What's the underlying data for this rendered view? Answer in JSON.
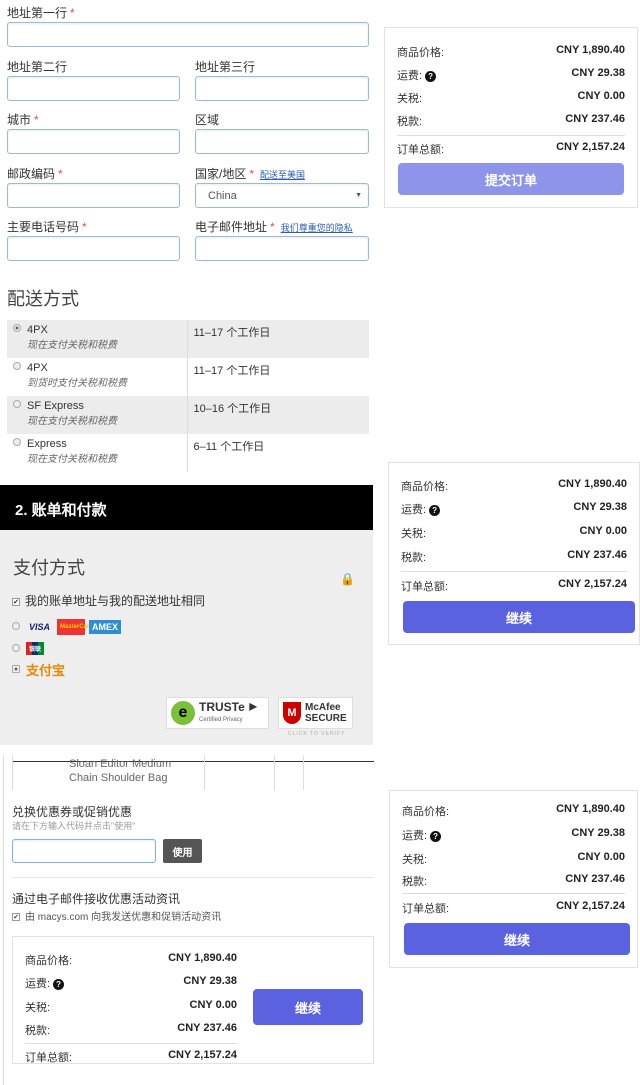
{
  "address_form": {
    "line1_label": "地址第一行",
    "line2_label": "地址第二行",
    "line3_label": "地址第三行",
    "city_label": "城市",
    "region_label": "区域",
    "postal_label": "邮政编码",
    "country_label": "国家/地区",
    "ship_to_us_link": "配送至美国",
    "country_value": "China",
    "phone_label": "主要电话号码",
    "email_label": "电子邮件地址",
    "privacy_link": "我们尊重您的隐私",
    "required_mark": "*"
  },
  "shipping": {
    "title": "配送方式",
    "options": [
      {
        "name": "4PX",
        "note": "现在支付关税和税费",
        "time": "11–17 个工作日",
        "selected": true
      },
      {
        "name": "4PX",
        "note": "到货时支付关税和税费",
        "time": "11–17 个工作日",
        "selected": false
      },
      {
        "name": "SF Express",
        "note": "现在支付关税和税费",
        "time": "10–16 个工作日",
        "selected": false
      },
      {
        "name": "Express",
        "note": "现在支付关税和税费",
        "time": "6–11 个工作日",
        "selected": false
      }
    ]
  },
  "billing": {
    "header": "2. 账单和付款",
    "title": "支付方式",
    "same_address": "我的账单地址与我的配送地址相同",
    "cards": {
      "visa": "VISA",
      "mastercard": "MasterCard",
      "amex": "AMEX",
      "unionpay": "银联",
      "alipay": "支付宝"
    },
    "truste": "TRUSTe",
    "truste_sub": "Certified Privacy",
    "mcafee": "McAfee",
    "mcafee_sub": "SECURE",
    "mcafee_verify": "CLICK TO VERIFY"
  },
  "cart": {
    "item_name": "Sloan Editor Medium Chain Shoulder Bag"
  },
  "coupon": {
    "title": "兑换优惠券或促销优惠",
    "hint": "请在下方输入代码并点击\"使用\"",
    "apply": "使用"
  },
  "newsletter": {
    "title": "通过电子邮件接收优惠活动资讯",
    "checkbox": "由 macys.com 向我发送优惠和促销活动资讯"
  },
  "summary": {
    "rows": [
      {
        "label": "商品价格:",
        "value": "CNY 1,890.40"
      },
      {
        "label": "运费:",
        "value": "CNY 29.38"
      },
      {
        "label": "关税:",
        "value": "CNY 0.00"
      },
      {
        "label": "税款:",
        "value": "CNY 237.46"
      }
    ],
    "total_label": "订单总额:",
    "total_value": "CNY 2,157.24",
    "help_icon": "?",
    "submit_label": "提交订单",
    "continue_label": "继续"
  },
  "colors": {
    "accent": "#5b62e0",
    "accent_disabled": "#8e94ea",
    "header_bg": "#000000"
  }
}
